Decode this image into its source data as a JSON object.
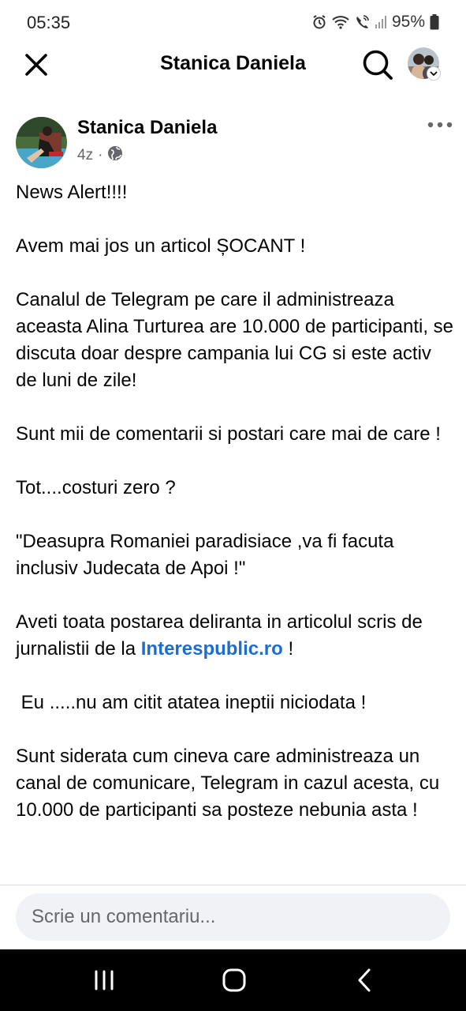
{
  "status_bar": {
    "time": "05:35",
    "battery": "95%",
    "icons": [
      "alarm-icon",
      "wifi-icon",
      "wifi-call-icon",
      "signal-icon",
      "battery-icon"
    ]
  },
  "top_bar": {
    "title": "Stanica Daniela",
    "icons": [
      "close-icon",
      "search-icon"
    ]
  },
  "post": {
    "author": "Stanica Daniela",
    "time": "4z",
    "separator": "·",
    "privacy_icon": "globe-icon",
    "paragraphs": {
      "p1": "News Alert!!!!",
      "p2": "Avem mai jos un articol ȘOCANT !",
      "p3": "Canalul de Telegram pe care il administreaza aceasta Alina Turturea are 10.000 de participanti, se discuta doar despre campania lui CG si este activ de luni de zile!",
      "p4": "Sunt mii de comentarii si postari  care mai de care !",
      "p5": "Tot....costuri zero ?",
      "p6": "\"Deasupra Romaniei paradisiace ,va fi facuta inclusiv Judecata de Apoi !\"",
      "p7_before": "Aveti toata postarea deliranta in articolul scris de jurnalistii de la ",
      "p7_link": "Interespublic.ro",
      "p7_after": " !",
      "p8": " Eu .....nu am citit atatea ineptii niciodata !",
      "p9": "Sunt siderata cum cineva care administreaza un canal de comunicare, Telegram in cazul acesta, cu 10.000 de participanti sa posteze nebunia asta !"
    },
    "link_color": "#1c6dcf"
  },
  "comment": {
    "placeholder": "Scrie un comentariu..."
  },
  "nav_bar": {
    "icons": [
      "recent-apps-icon",
      "home-icon",
      "back-icon"
    ]
  }
}
